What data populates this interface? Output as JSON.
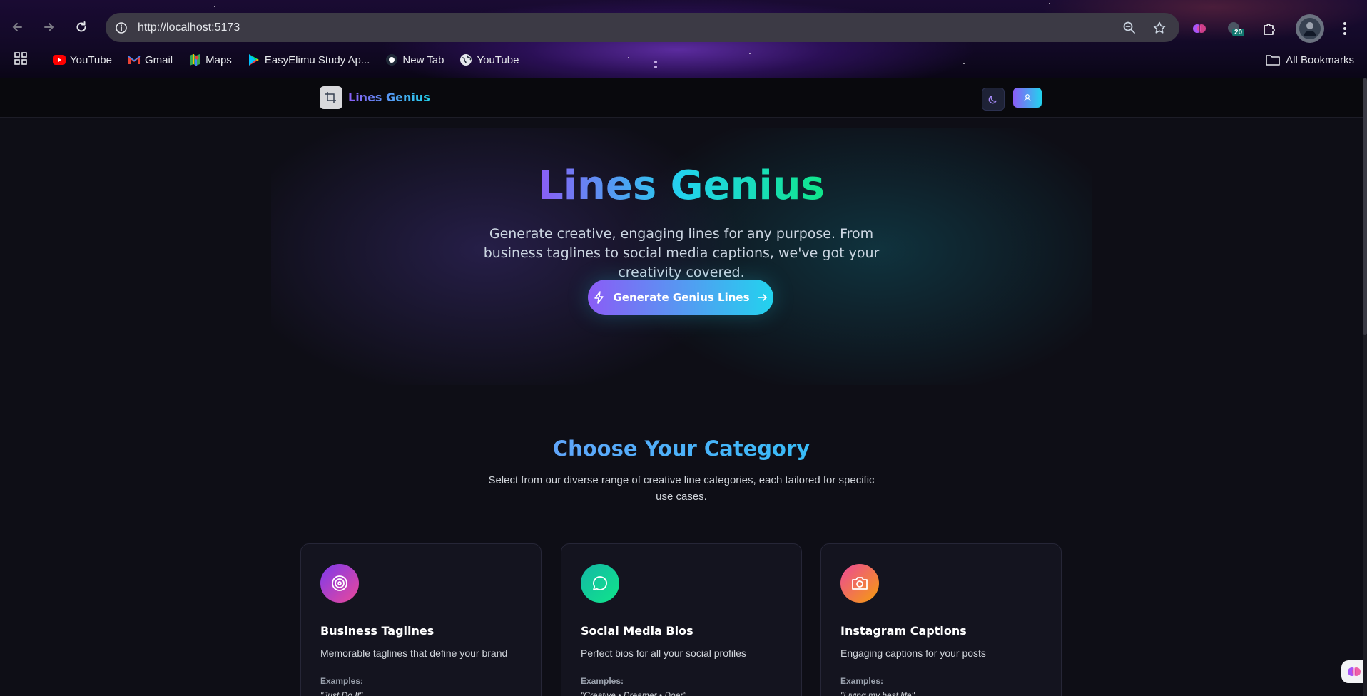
{
  "browser": {
    "url": "http://localhost:5173",
    "extension_badge": "20",
    "bookmarks": [
      {
        "label": "YouTube",
        "icon": "youtube-icon"
      },
      {
        "label": "Gmail",
        "icon": "gmail-icon"
      },
      {
        "label": "Maps",
        "icon": "maps-icon"
      },
      {
        "label": "EasyElimu Study Ap...",
        "icon": "play-store-icon"
      },
      {
        "label": "New Tab",
        "icon": "new-tab-icon"
      },
      {
        "label": "YouTube",
        "icon": "globe-icon"
      }
    ],
    "all_bookmarks": "All Bookmarks"
  },
  "header": {
    "brand": "Lines Genius"
  },
  "hero": {
    "title": "Lines Genius",
    "subtitle": "Generate creative, engaging lines for any purpose. From business taglines to social media captions, we've got your creativity covered.",
    "cta": "Generate Genius Lines"
  },
  "categories": {
    "title": "Choose Your Category",
    "subtitle": "Select from our diverse range of creative line categories, each tailored for specific use cases.",
    "examples_label": "Examples:",
    "cards": [
      {
        "title": "Business Taglines",
        "desc": "Memorable taglines that define your brand",
        "example": "\"Just Do It\"",
        "icon": "target-icon"
      },
      {
        "title": "Social Media Bios",
        "desc": "Perfect bios for all your social profiles",
        "example": "\"Creative • Dreamer • Doer\"",
        "icon": "chat-bubble-icon"
      },
      {
        "title": "Instagram Captions",
        "desc": "Engaging captions for your posts",
        "example": "\"Living my best life\"",
        "icon": "camera-icon"
      }
    ]
  },
  "colors": {
    "accent_purple": "#8b5cf6",
    "accent_cyan": "#22d3ee",
    "accent_green": "#10e58a",
    "background": "#0e0e16"
  }
}
